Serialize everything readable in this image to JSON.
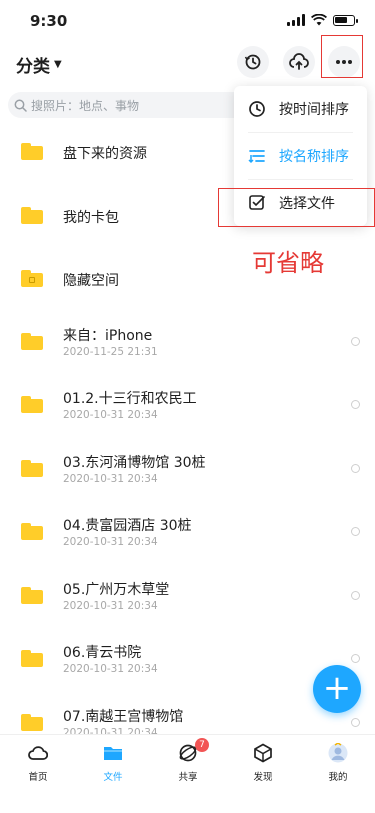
{
  "status_bar": {
    "time": "9:30"
  },
  "header": {
    "title": "分类"
  },
  "search": {
    "placeholder": "搜照片：地点、事物"
  },
  "menu": {
    "items": [
      {
        "label": "按时间排序",
        "icon": "clock-icon"
      },
      {
        "label": "按名称排序",
        "icon": "sort-icon"
      },
      {
        "label": "选择文件",
        "icon": "checkbox-icon"
      }
    ],
    "active_index": 1,
    "active_color": "#1ea7ff"
  },
  "annotation": {
    "text": "可省略",
    "color": "#e53935"
  },
  "files": [
    {
      "name": "盘下来的资源",
      "date": ""
    },
    {
      "name": "我的卡包",
      "date": ""
    },
    {
      "name": "隐藏空间",
      "date": ""
    },
    {
      "name": "来自：iPhone",
      "date": "2020-11-25 21:31"
    },
    {
      "name": "01.2.十三行和农民工",
      "date": "2020-10-31 20:34"
    },
    {
      "name": "03.东河涌博物馆 30桩",
      "date": "2020-10-31 20:34"
    },
    {
      "name": "04.贵富园酒店 30桩",
      "date": "2020-10-31 20:34"
    },
    {
      "name": "05.广州万木草堂",
      "date": "2020-10-31 20:34"
    },
    {
      "name": "06.青云书院",
      "date": "2020-10-31 20:34"
    },
    {
      "name": "07.南越王宫博物馆",
      "date": "2020-10-31 20:34"
    }
  ],
  "fab": {
    "label": "+"
  },
  "tabbar": {
    "tabs": [
      {
        "label": "首页",
        "icon": "cloud-icon"
      },
      {
        "label": "文件",
        "icon": "folder-icon"
      },
      {
        "label": "共享",
        "icon": "share-icon",
        "badge": "7"
      },
      {
        "label": "发现",
        "icon": "cube-icon"
      },
      {
        "label": "我的",
        "icon": "avatar-icon"
      }
    ],
    "active_index": 1
  }
}
